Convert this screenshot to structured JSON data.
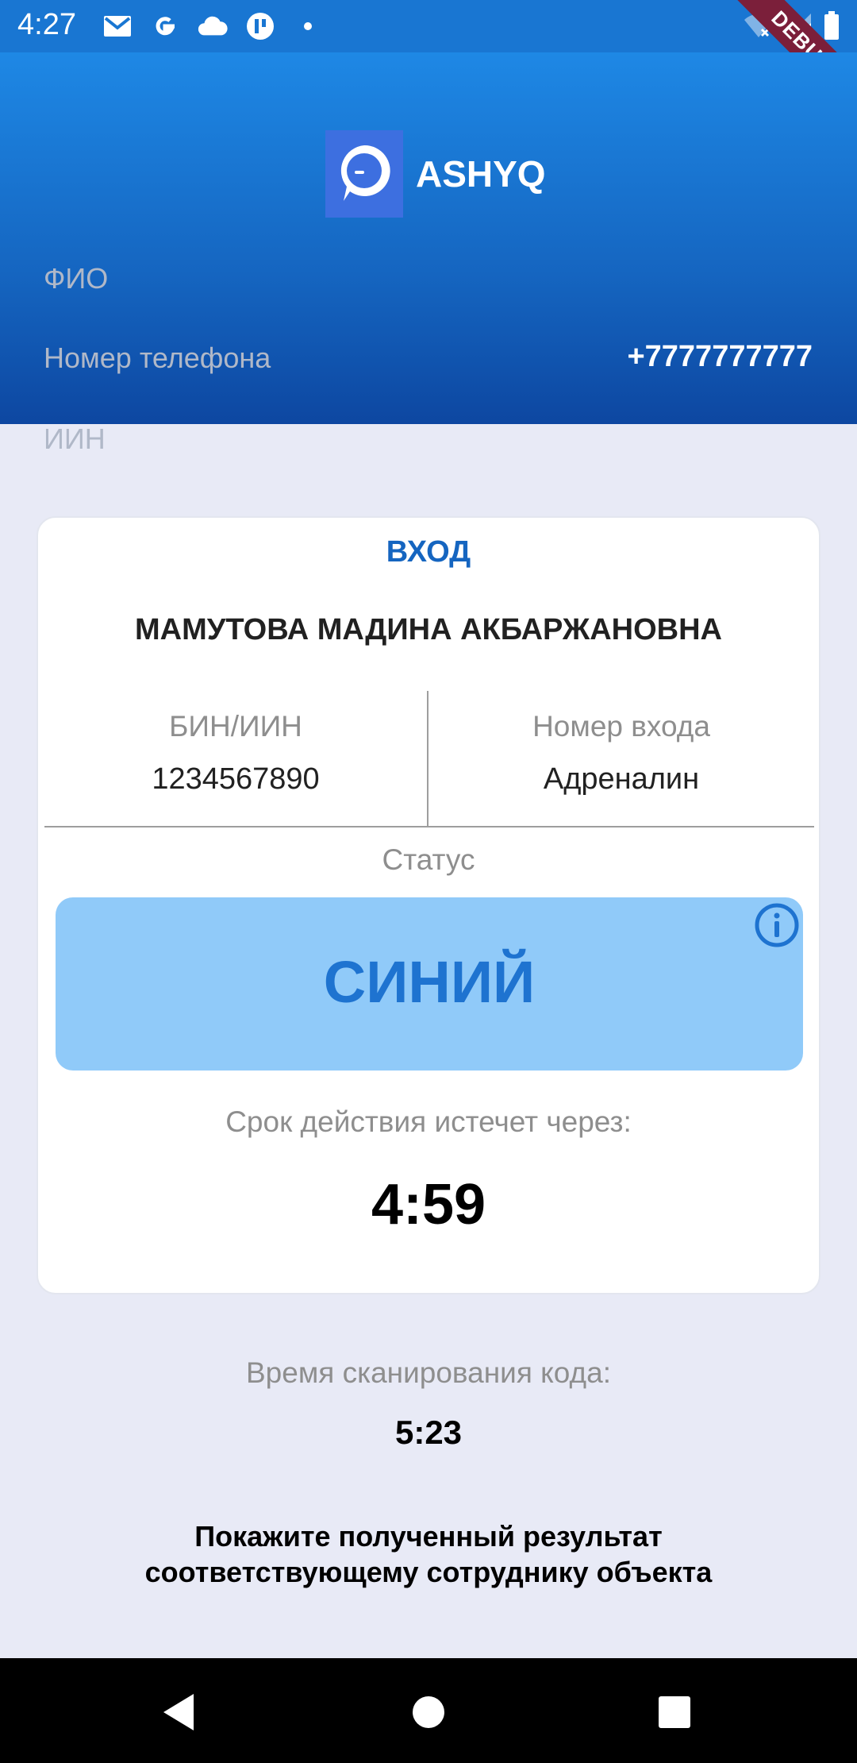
{
  "status_bar": {
    "time": "4:27",
    "left_icons": [
      "gmail-icon",
      "google-icon",
      "cloud-icon",
      "app-icon",
      "dot-icon"
    ],
    "right_icons": [
      "wifi-off-icon",
      "lte-signal-icon",
      "battery-icon"
    ],
    "debug_label": "DEBUG"
  },
  "header": {
    "app_name": "ASHYQ",
    "fio_label": "ФИО",
    "phone_label": "Номер телефона",
    "phone_value": "+7777777777",
    "iin_label": "ИИН"
  },
  "card": {
    "title": "ВХОД",
    "person_name": "МАМУТОВА МАДИНА АКБАРЖАНОВНА",
    "bin_label": "БИН/ИИН",
    "bin_value": "1234567890",
    "entry_label": "Номер входа",
    "entry_value": "Адреналин",
    "status_label": "Статус",
    "status_value": "СИНИЙ",
    "expire_label": "Срок действия истечет через:",
    "expire_value": "4:59"
  },
  "scan": {
    "label": "Время сканирования кода:",
    "value": "5:23"
  },
  "notice": {
    "line1": "Покажите полученный результат",
    "line2": "соответствующему сотруднику объекта"
  },
  "nav": [
    "back-icon",
    "home-icon",
    "recents-icon"
  ],
  "colors": {
    "primary": "#1976D2",
    "status_bg": "#90CAF9",
    "status_text": "#1E73D0",
    "background": "#E8EAF6"
  }
}
